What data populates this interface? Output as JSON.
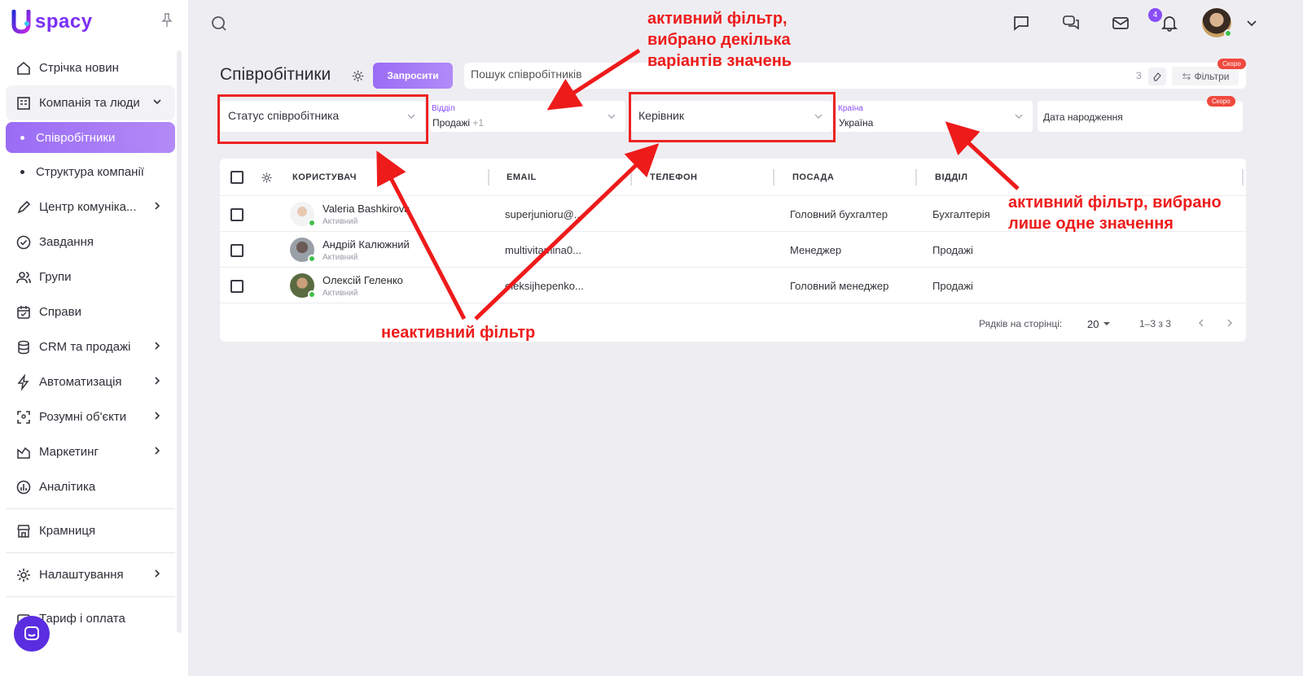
{
  "app": {
    "logo_text": "spacy"
  },
  "sidebar": {
    "items": [
      {
        "label": "Стрічка новин"
      },
      {
        "label": "Компанія та люди"
      },
      {
        "label": "Співробітники"
      },
      {
        "label": "Структура компанії"
      },
      {
        "label": "Центр комуніка..."
      },
      {
        "label": "Завдання"
      },
      {
        "label": "Групи"
      },
      {
        "label": "Справи"
      },
      {
        "label": "CRM та продажі"
      },
      {
        "label": "Автоматизація"
      },
      {
        "label": "Розумні об'єкти"
      },
      {
        "label": "Маркетинг"
      },
      {
        "label": "Аналітика"
      },
      {
        "label": "Крамниця"
      },
      {
        "label": "Налаштування"
      },
      {
        "label": "Тариф і оплата"
      }
    ]
  },
  "topbar": {
    "mail_badge": "4"
  },
  "page": {
    "title": "Співробітники",
    "invite_label": "Запросити",
    "search_placeholder": "Пошук співробітників",
    "search_count": "3",
    "filters_label": "Фільтри",
    "soon_label": "Скоро"
  },
  "filters": {
    "status": {
      "label": "Статус співробітника"
    },
    "department": {
      "caption": "Відділ",
      "value": "Продажі",
      "extra": "+1"
    },
    "manager": {
      "label": "Керівник"
    },
    "country": {
      "caption": "Країна",
      "value": "Україна"
    },
    "birthday": {
      "label": "Дата народження",
      "soon": "Скоро"
    }
  },
  "table": {
    "columns": [
      "КОРИСТУВАЧ",
      "EMAIL",
      "ТЕЛЕФОН",
      "ПОСАДА",
      "ВІДДІЛ"
    ],
    "rows": [
      {
        "name": "Valeria Bashkirova",
        "status": "Активний",
        "email": "superjunioru@...",
        "phone": "",
        "position": "Головний бухгалтер",
        "department": "Бухгалтерія"
      },
      {
        "name": "Андрій Калюжний",
        "status": "Активний",
        "email": "multivitamina0...",
        "phone": "",
        "position": "Менеджер",
        "department": "Продажі"
      },
      {
        "name": "Олексій Геленко",
        "status": "Активний",
        "email": "oleksijhepenko...",
        "phone": "",
        "position": "Головний менеджер",
        "department": "Продажі"
      }
    ],
    "rows_per_page_label": "Рядків на сторінці:",
    "rows_per_page": "20",
    "range": "1–3 з 3"
  },
  "annotations": {
    "top": [
      "активний фільтр,",
      "вибрано декілька",
      "варіантів значень"
    ],
    "right": [
      "активний фільтр, вибрано",
      "лише одне значення"
    ],
    "bottom": "неактивний фільтр"
  },
  "colors": {
    "accent": "#9a6cf5",
    "annotation": "#ee1b1b",
    "online": "#3fbf4a"
  }
}
